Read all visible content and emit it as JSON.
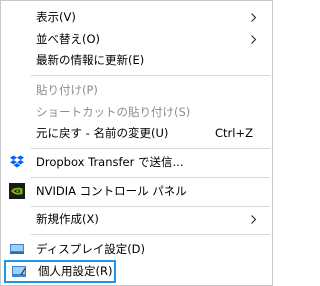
{
  "menu": {
    "items": [
      {
        "label": "表示(V)"
      },
      {
        "label": "並べ替え(O)"
      },
      {
        "label": "最新の情報に更新(E)"
      },
      {
        "label": "貼り付け(P)"
      },
      {
        "label": "ショートカットの貼り付け(S)"
      },
      {
        "label": "元に戻す - 名前の変更(U)",
        "shortcut": "Ctrl+Z"
      },
      {
        "label": "Dropbox Transfer で送信..."
      },
      {
        "label": "NVIDIA コントロール パネル"
      },
      {
        "label": "新規作成(X)"
      },
      {
        "label": "ディスプレイ設定(D)"
      },
      {
        "label": "個人用設定(R)"
      }
    ]
  },
  "colors": {
    "disabled_text": "#8c8c8c",
    "highlight_border": "#1e96ee",
    "dropbox_blue": "#0061fe",
    "nvidia_green": "#76b900"
  },
  "icons": {
    "dropbox": "dropbox-icon",
    "nvidia": "nvidia-icon",
    "display": "display-settings-icon",
    "personalize": "personalize-icon",
    "submenu": "chevron-right-icon"
  }
}
